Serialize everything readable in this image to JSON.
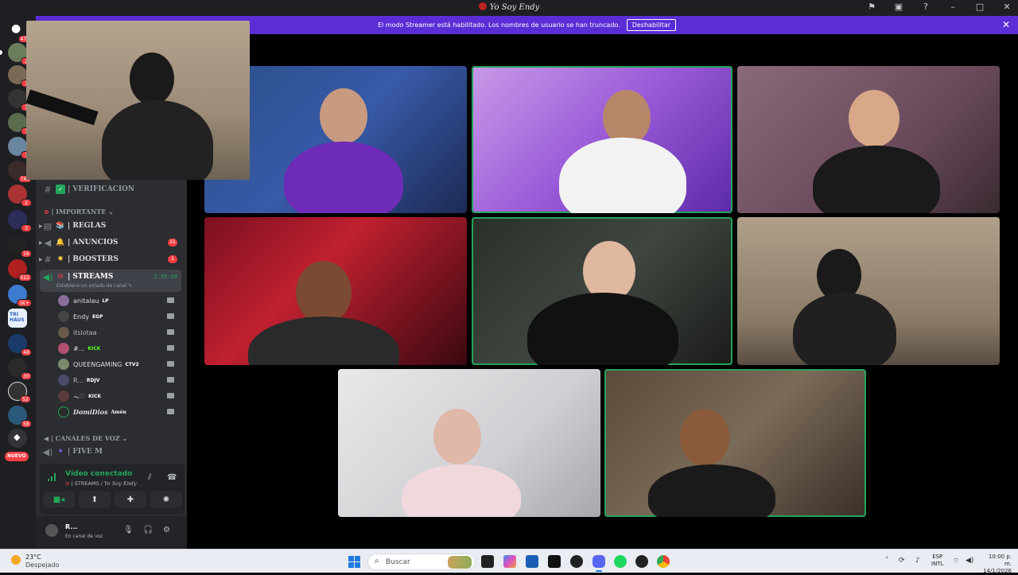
{
  "window": {
    "title": "Yo Soy Endy"
  },
  "banner": {
    "text": "El modo Streamer está habilitado. Los nombres de usuario se han truncado.",
    "button": "Deshabilitar"
  },
  "rail": {
    "servers": [
      {
        "badge": "474"
      },
      {
        "badge": "2"
      },
      {
        "badge": "3"
      },
      {
        "badge": "1"
      },
      {
        "badge": "1"
      },
      {
        "badge": "1"
      },
      {
        "badge": "740"
      },
      {
        "badge": "2"
      },
      {
        "badge": "3"
      },
      {
        "badge": "16"
      },
      {
        "badge": "522"
      },
      {
        "badge": "1K+"
      },
      {
        "badge": ""
      },
      {
        "badge": "48"
      },
      {
        "badge": "30"
      },
      {
        "badge": "52"
      },
      {
        "badge": "58"
      }
    ],
    "new_label": "NUEVO"
  },
  "sidebar": {
    "verificacion": "| VERIFICACION",
    "cat_importante": "| IMPORTANTE",
    "reglas": "| REGLAS",
    "anuncios": "| ANUNCIOS",
    "anuncios_badge": "31",
    "boosters": "| BOOSTERS",
    "boosters_badge": "1",
    "streams": "| STREAMS",
    "streams_status": "Establece un estado de canal",
    "streams_time": "2:35:50",
    "members": [
      {
        "name": "anitalau",
        "tag": "LP"
      },
      {
        "name": "Endy",
        "tag": "EGP"
      },
      {
        "name": "itslotaa",
        "tag": ""
      },
      {
        "name": "#...",
        "tag": "KICK"
      },
      {
        "name": "QUEENGAMING",
        "tag": "CTV2"
      },
      {
        "name": "R...",
        "tag": "RDJV"
      },
      {
        "name": "ᯓ♡",
        "tag": "KICK"
      },
      {
        "name": "DomiDios",
        "tag": "Amén"
      }
    ],
    "cat_voz": "| CANALES DE VOZ",
    "five_m": "| FIVE M"
  },
  "voice_panel": {
    "status": "Vídeo conectado",
    "channel": "| STREAMS / ",
    "server": "Yo Soy Endy"
  },
  "user": {
    "name": "R...",
    "status": "En canal de voz"
  },
  "taskbar": {
    "temp": "23°C",
    "weather": "Despejado",
    "search": "Buscar",
    "lang1": "ESP",
    "lang2": "INTL",
    "time": "10:00 p. m.",
    "date": "14/1/2026"
  },
  "colors": {
    "accent": "#5b2dd6",
    "speaking": "#23a55a",
    "badge": "#f23f43"
  }
}
